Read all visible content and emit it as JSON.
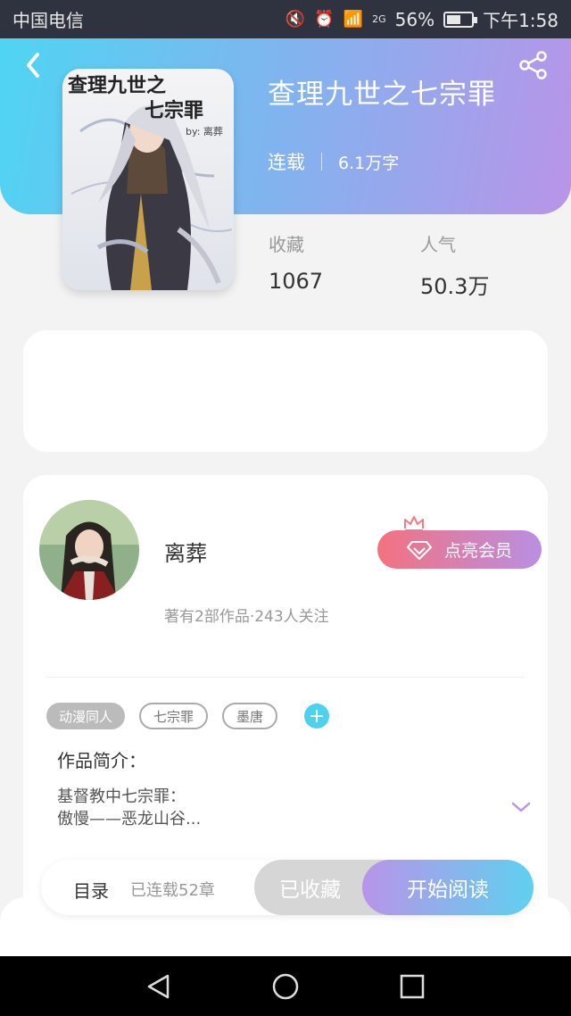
{
  "status_bar": {
    "carrier": "中国电信",
    "battery_percent": "56%",
    "battery_level": 0.56,
    "network": "2G",
    "time": "下午1:58"
  },
  "header": {
    "back_icon": "chevron-left-icon",
    "share_icon": "share-icon"
  },
  "book": {
    "title": "查理九世之七宗罪",
    "status": "连载",
    "word_count": "6.1万字",
    "cover_text_line1": "查理九世之",
    "cover_text_line2": "七宗罪",
    "cover_signature": "by: 离葬",
    "stats": [
      {
        "label": "收藏",
        "value": "1067"
      },
      {
        "label": "人气",
        "value": "50.3万"
      }
    ]
  },
  "author": {
    "name": "离葬",
    "vip_button": "点亮会员",
    "stats_text": "著有2部作品·243人关注"
  },
  "tags": [
    "动漫同人",
    "七宗罪",
    "墨唐"
  ],
  "tag_add": "+",
  "intro": {
    "title": "作品简介：",
    "line1": "基督教中七宗罪：",
    "line2": "傲慢——恶龙山谷..."
  },
  "bottom": {
    "toc": "目录",
    "chapters": "已连载52章",
    "collected": "已收藏",
    "read": "开始阅读"
  },
  "colors": {
    "header_start": "#4fd5f3",
    "header_end": "#b994e8",
    "accent_cyan": "#4ed0ef",
    "vip_start": "#f3727f",
    "vip_end": "#b98fe3"
  }
}
